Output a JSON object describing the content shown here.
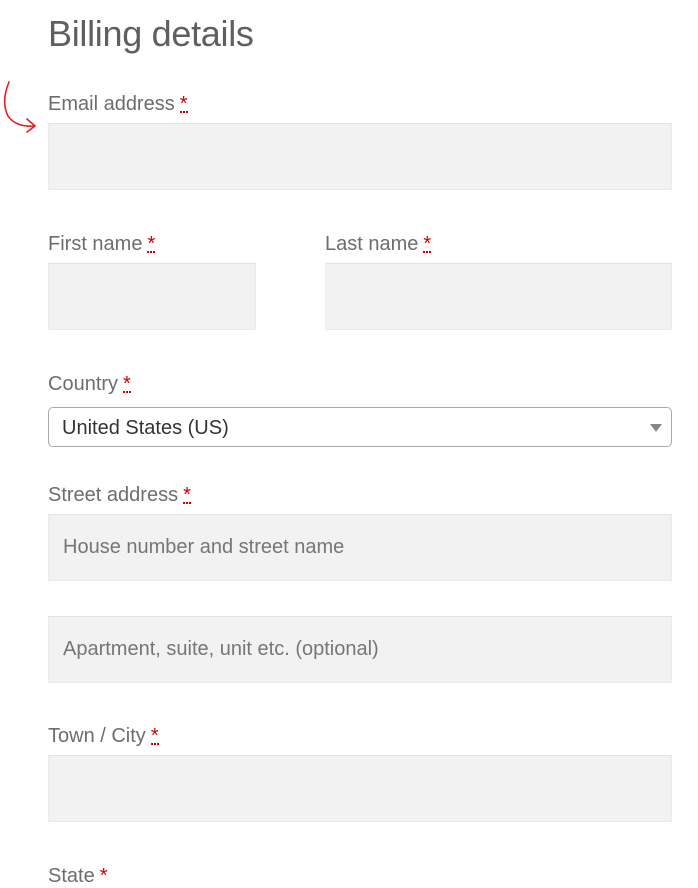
{
  "form": {
    "title": "Billing details",
    "required_marker": "*",
    "email": {
      "label": "Email address",
      "value": "",
      "placeholder": ""
    },
    "first_name": {
      "label": "First name",
      "value": "",
      "placeholder": ""
    },
    "last_name": {
      "label": "Last name",
      "value": "",
      "placeholder": ""
    },
    "country": {
      "label": "Country",
      "selected": "United States (US)"
    },
    "street": {
      "label": "Street address",
      "line1_placeholder": "House number and street name",
      "line2_placeholder": "Apartment, suite, unit etc. (optional)"
    },
    "city": {
      "label": "Town / City",
      "value": "",
      "placeholder": ""
    },
    "state": {
      "label": "State"
    }
  },
  "colors": {
    "required": "#cc0000",
    "input_background": "#f2f2f2",
    "annotation": "#e02020"
  },
  "icons": {
    "annotation": "hand-drawn-arrow-icon",
    "select_arrow": "chevron-down-icon"
  }
}
